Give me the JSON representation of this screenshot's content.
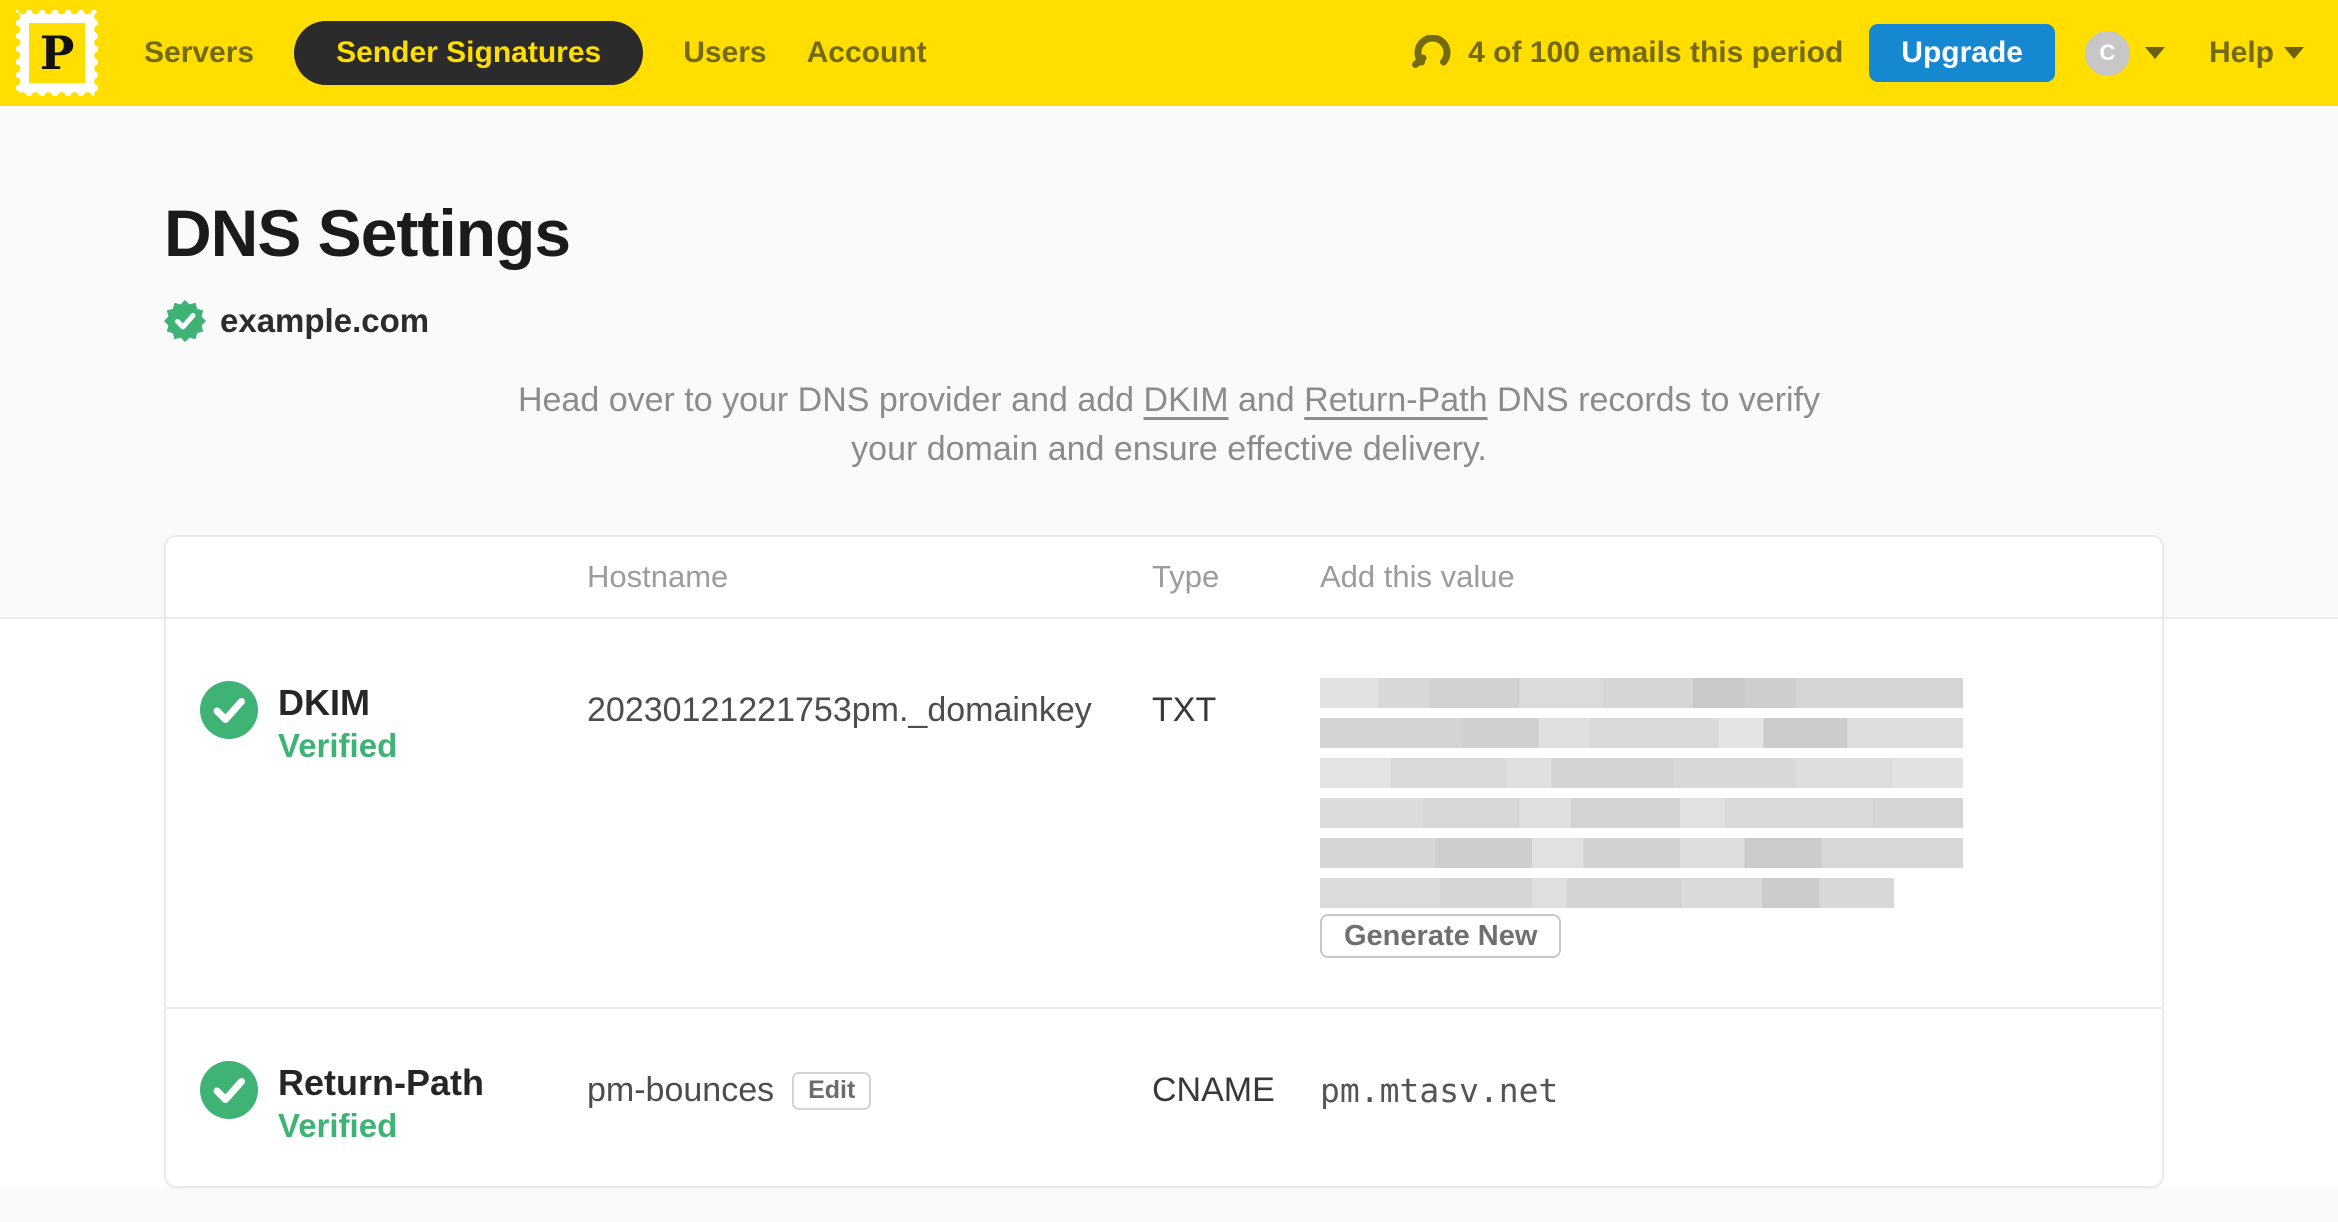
{
  "nav": {
    "logo_letter": "P",
    "items": [
      {
        "label": "Servers",
        "active": false
      },
      {
        "label": "Sender Signatures",
        "active": true
      },
      {
        "label": "Users",
        "active": false
      },
      {
        "label": "Account",
        "active": false
      }
    ],
    "usage_text": "4 of 100 emails this period",
    "upgrade_label": "Upgrade",
    "avatar_initial": "C",
    "help_label": "Help"
  },
  "hero": {
    "title": "DNS Settings",
    "domain": "example.com",
    "domain_verified": true,
    "description": {
      "part1": "Head over to your DNS provider and add ",
      "link_dkim": "DKIM",
      "part2": " and ",
      "link_return_path": "Return-Path",
      "part3": " DNS records to verify your domain and ensure effective delivery."
    }
  },
  "table": {
    "headers": {
      "hostname": "Hostname",
      "type": "Type",
      "value": "Add this value"
    },
    "rows": {
      "dkim": {
        "label": "DKIM",
        "status": "Verified",
        "hostname": "20230121221753pm._domainkey",
        "record_type": "TXT",
        "value_redacted": true,
        "value_redacted_lines": 6,
        "action_label": "Generate New"
      },
      "return_path": {
        "label": "Return-Path",
        "status": "Verified",
        "hostname": "pm-bounces",
        "edit_label": "Edit",
        "record_type": "CNAME",
        "value": "pm.mtasv.net"
      }
    }
  },
  "colors": {
    "brand_yellow": "#FFDE00",
    "nav_text_olive": "#746A12",
    "active_pill_bg": "#2B2B2B",
    "upgrade_blue": "#1588D1",
    "verified_green": "#3EB375"
  }
}
